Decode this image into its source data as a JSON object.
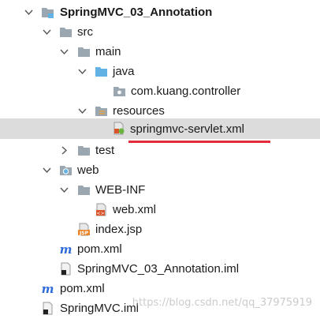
{
  "tree": {
    "project": "SpringMVC_03_Annotation",
    "src": "src",
    "main": "main",
    "java": "java",
    "package": "com.kuang.controller",
    "resources": "resources",
    "servlet_xml": "springmvc-servlet.xml",
    "test": "test",
    "web": "web",
    "web_inf": "WEB-INF",
    "web_xml": "web.xml",
    "index_jsp": "index.jsp",
    "pom_inner": "pom.xml",
    "module_iml": "SpringMVC_03_Annotation.iml",
    "pom_outer": "pom.xml",
    "outer_iml": "SpringMVC.iml"
  },
  "selected_item": "springmvc-servlet.xml",
  "watermark": "https://blog.csdn.net/qq_37975919",
  "colors": {
    "selection": "#dcdcdc",
    "underline": "#e32b3a",
    "folder": "#9aa7b0",
    "source_folder": "#62b3e3"
  }
}
